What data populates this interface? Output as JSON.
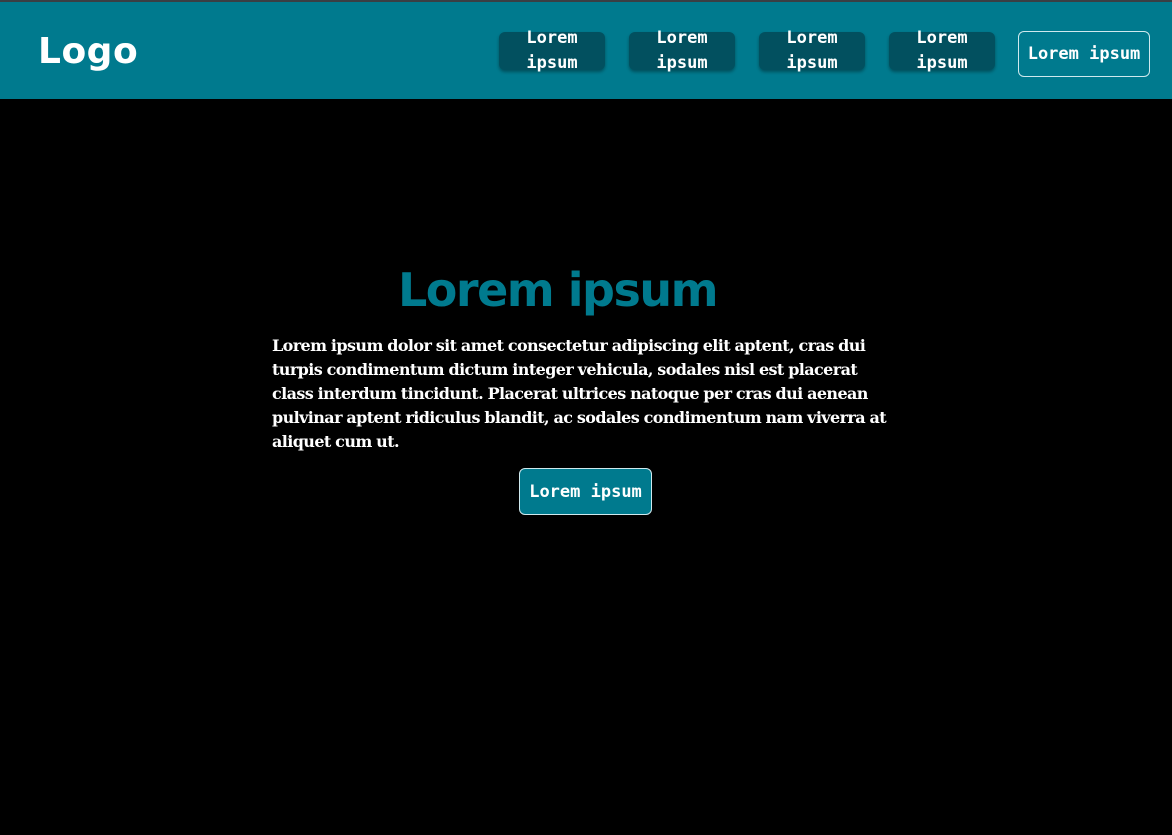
{
  "header": {
    "logo": "Logo",
    "nav_items": [
      {
        "label": "Lorem ipsum"
      },
      {
        "label": "Lorem ipsum"
      },
      {
        "label": "Lorem ipsum"
      },
      {
        "label": "Lorem ipsum"
      }
    ],
    "cta_label": "Lorem ipsum"
  },
  "hero": {
    "title": "Lorem ipsum",
    "body": "Lorem ipsum dolor sit amet consectetur adipiscing elit aptent, cras dui turpis condimentum dictum integer vehicula, sodales nisl est placerat class interdum tincidunt. Placerat ultrices natoque per cras dui aenean pulvinar aptent ridiculus blandit, ac sodales condimentum nam viverra at aliquet cum ut.",
    "button_label": "Lorem ipsum"
  },
  "colors": {
    "navbar_bg": "#007a8e",
    "nav_button_bg": "#02505f",
    "page_bg": "#000000",
    "title_color": "#007a8e",
    "text_color": "#ffffff"
  }
}
